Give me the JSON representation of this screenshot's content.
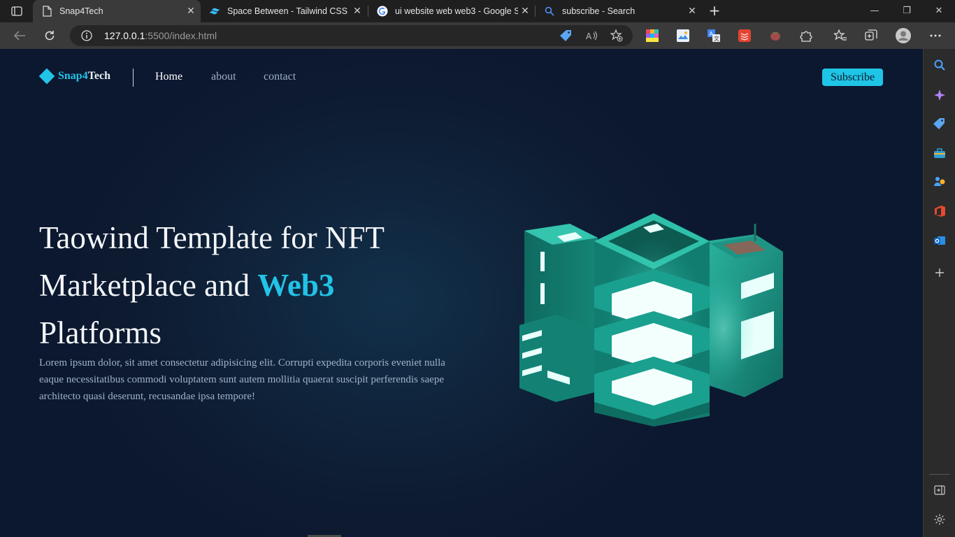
{
  "browser": {
    "tabs": [
      {
        "title": "Snap4Tech",
        "favicon": "page-icon",
        "active": true
      },
      {
        "title": "Space Between - Tailwind CSS",
        "favicon": "tailwind-icon",
        "active": false
      },
      {
        "title": "ui website web web3 - Google Se",
        "favicon": "google-icon",
        "active": false
      },
      {
        "title": "subscribe - Search",
        "favicon": "search-icon",
        "active": false
      }
    ],
    "url_host": "127.0.0.1",
    "url_rest": ":5500/index.html"
  },
  "site": {
    "brand_prefix": "Snap4",
    "brand_suffix": "Tech",
    "nav": [
      {
        "label": "Home",
        "current": true
      },
      {
        "label": "about",
        "current": false
      },
      {
        "label": "contact",
        "current": false
      }
    ],
    "cta": "Subscribe",
    "hero": {
      "title_line1": "Taowind Template for NFT",
      "title_line2": "Marketplace and ",
      "title_highlight": "Web3",
      "title_line3": "Platforms",
      "body": "Lorem ipsum dolor, sit amet consectetur adipisicing elit. Corrupti expedita corporis eveniet nulla eaque necessitatibus commodi voluptatem sunt autem mollitia quaerat suscipit perferendis saepe architecto quasi deserunt, recusandae ipsa tempore!"
    }
  },
  "colors": {
    "accent": "#22c3e6",
    "page_bg": "#0d1a30",
    "building": "#1a8f7e"
  }
}
